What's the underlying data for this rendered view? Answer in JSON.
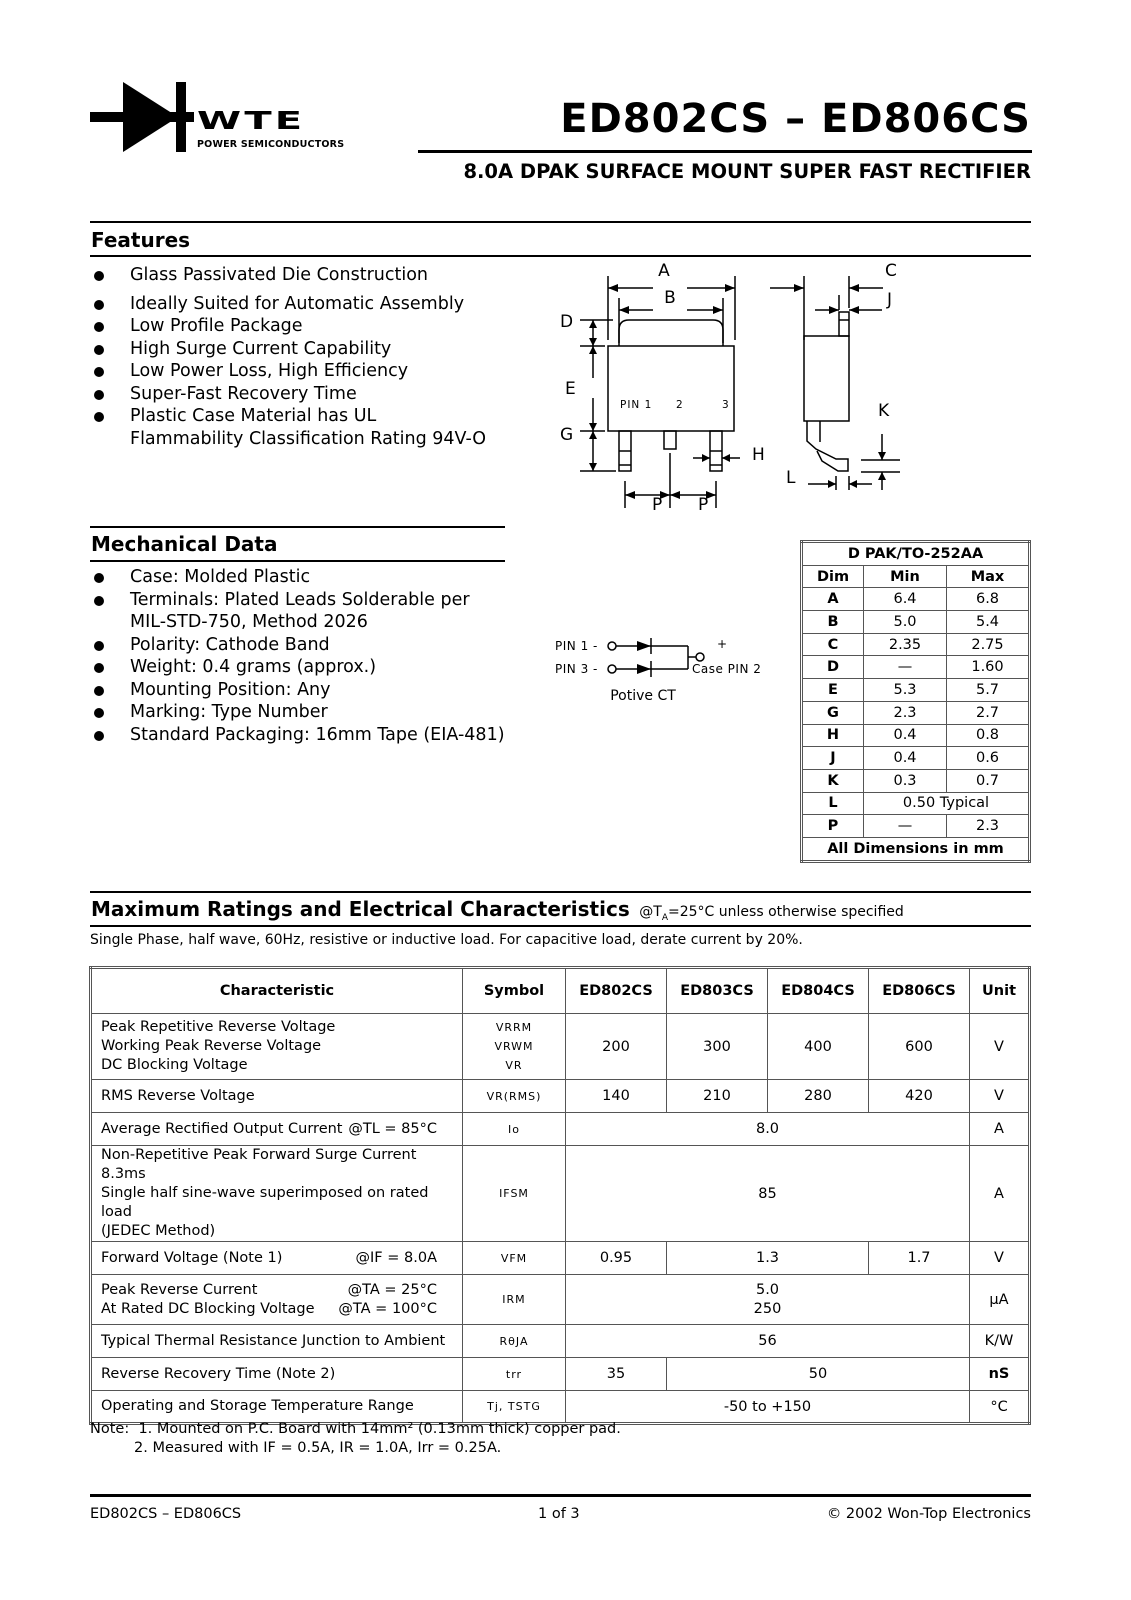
{
  "header": {
    "logo_text": "WTE",
    "logo_subtext": "POWER SEMICONDUCTORS",
    "title": "ED802CS – ED806CS",
    "subtitle": "8.0A DPAK SURFACE MOUNT SUPER FAST RECTIFIER"
  },
  "features": {
    "title": "Features",
    "items": [
      "Glass Passivated Die Construction",
      "Ideally Suited for Automatic Assembly",
      "Low Profile Package",
      "High Surge Current Capability",
      "Low Power Loss, High Efficiency",
      "Super-Fast Recovery Time",
      "Plastic Case Material has UL Flammability Classification Rating 94V-O"
    ]
  },
  "mechanical": {
    "title": "Mechanical Data",
    "items": [
      "Case: Molded Plastic",
      "Terminals: Plated Leads Solderable per MIL-STD-750, Method 2026",
      "Polarity: Cathode Band",
      "Weight: 0.4 grams (approx.)",
      "Mounting Position: Any",
      "Marking: Type Number",
      "Standard Packaging: 16mm Tape (EIA-481)"
    ]
  },
  "package_drawing": {
    "labels": {
      "A": "A",
      "B": "B",
      "C": "C",
      "D": "D",
      "E": "E",
      "G": "G",
      "H": "H",
      "J": "J",
      "K": "K",
      "L": "L",
      "P": "P"
    },
    "pin1": "PIN 1",
    "pin2": "2",
    "pin3": "3"
  },
  "schematic": {
    "pin1": "PIN 1 -",
    "pin3": "PIN 3 -",
    "plus": "+",
    "case": "Case PIN 2",
    "caption": "Potive CT"
  },
  "dim_table": {
    "title": "D PAK/TO-252AA",
    "headers": [
      "Dim",
      "Min",
      "Max"
    ],
    "rows": [
      {
        "dim": "A",
        "min": "6.4",
        "max": "6.8"
      },
      {
        "dim": "B",
        "min": "5.0",
        "max": "5.4"
      },
      {
        "dim": "C",
        "min": "2.35",
        "max": "2.75"
      },
      {
        "dim": "D",
        "min": "—",
        "max": "1.60"
      },
      {
        "dim": "E",
        "min": "5.3",
        "max": "5.7"
      },
      {
        "dim": "G",
        "min": "2.3",
        "max": "2.7"
      },
      {
        "dim": "H",
        "min": "0.4",
        "max": "0.8"
      },
      {
        "dim": "J",
        "min": "0.4",
        "max": "0.6"
      },
      {
        "dim": "K",
        "min": "0.3",
        "max": "0.7"
      },
      {
        "dim": "L",
        "typical": "0.50 Typical"
      },
      {
        "dim": "P",
        "min": "—",
        "max": "2.3"
      }
    ],
    "footer": "All Dimensions in mm"
  },
  "ratings": {
    "title": "Maximum Ratings and Electrical Characteristics",
    "condition_prefix": "@T",
    "condition_sub": "A",
    "condition_suffix": "=25°C unless otherwise specified",
    "note": "Single Phase, half wave, 60Hz, resistive or inductive load. For capacitive load, derate current by 20%.",
    "headers": [
      "Characteristic",
      "Symbol",
      "ED802CS",
      "ED803CS",
      "ED804CS",
      "ED806CS",
      "Unit"
    ],
    "rows": {
      "vrrm": {
        "char": [
          "Peak Repetitive Reverse Voltage",
          "Working Peak Reverse Voltage",
          "DC Blocking Voltage"
        ],
        "sym": [
          "VRRM",
          "VRWM",
          "VR"
        ],
        "vals": [
          "200",
          "300",
          "400",
          "600"
        ],
        "unit": "V"
      },
      "vrms": {
        "char": "RMS Reverse Voltage",
        "sym": "VR(RMS)",
        "vals": [
          "140",
          "210",
          "280",
          "420"
        ],
        "unit": "V"
      },
      "io": {
        "char": "Average Rectified Output Current",
        "cond": "@TL = 85°C",
        "sym": "Io",
        "val": "8.0",
        "unit": "A"
      },
      "ifsm": {
        "char": [
          "Non-Repetitive Peak Forward Surge Current 8.3ms",
          "Single half sine-wave superimposed on rated load",
          "(JEDEC Method)"
        ],
        "sym": "IFSM",
        "val": "85",
        "unit": "A"
      },
      "vfm": {
        "char": "Forward Voltage (Note 1)",
        "cond": "@IF = 8.0A",
        "sym": "VFM",
        "vals": [
          "0.95",
          "1.3",
          "1.7"
        ],
        "unit": "V"
      },
      "irm": {
        "char": [
          "Peak Reverse Current",
          "At Rated DC Blocking Voltage"
        ],
        "cond": [
          "@TA = 25°C",
          "@TA = 100°C"
        ],
        "sym": "IRM",
        "vals": [
          "5.0",
          "250"
        ],
        "unit": "µA"
      },
      "rth": {
        "char": "Typical Thermal Resistance Junction to Ambient",
        "sym": "RθJA",
        "val": "56",
        "unit": "K/W"
      },
      "trr": {
        "char": "Reverse Recovery Time (Note 2)",
        "sym": "trr",
        "vals": [
          "35",
          "50"
        ],
        "unit": "nS"
      },
      "temp": {
        "char": "Operating and Storage Temperature Range",
        "sym": "Tj, TSTG",
        "val": "-50 to +150",
        "unit": "°C"
      }
    }
  },
  "notes": {
    "label": "Note:",
    "note1": "1. Mounted on P.C. Board with 14mm² (0.13mm thick) copper pad.",
    "note2": "2. Measured with IF = 0.5A, IR = 1.0A, Irr = 0.25A."
  },
  "footer": {
    "left": "ED802CS – ED806CS",
    "center": "1 of 3",
    "right": "© 2002 Won-Top Electronics"
  }
}
